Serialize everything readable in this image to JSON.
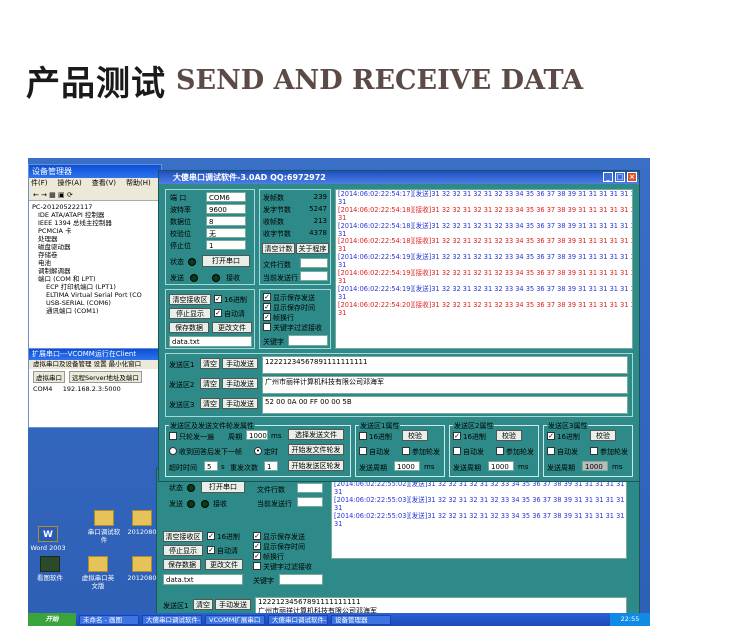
{
  "header": {
    "title_cn": "产品测试",
    "title_en": "SEND AND RECEIVE DATA"
  },
  "device_manager": {
    "title": "设备管理器",
    "menu": [
      "件(F)",
      "操作(A)",
      "查看(V)",
      "帮助(H)"
    ],
    "tree": [
      "PC-201205222117",
      "IDE ATA/ATAPI 控制器",
      "IEEE 1394 总线主控制器",
      "PCMCIA 卡",
      "处理器",
      "磁盘驱动器",
      "存储卷",
      "电池",
      "调制解调器",
      "端口 (COM 和 LPT)",
      "ECP 打印机端口 (LPT1)",
      "ELTIMA Virtual Serial Port (CO",
      "USB-SERIAL (COM6)",
      "通讯端口 (COM1)"
    ]
  },
  "ext_window": {
    "title": "扩展串口---VCOMM运行在Client",
    "menu": "虚拟串口及设备管理  设置  最小化窗口",
    "btn1": "虚拟串口",
    "btn2": "远程Server地址及端口",
    "row_port": "COM4",
    "row_addr": "192.168.2.3:5000"
  },
  "desktop_icons": [
    {
      "label": "Word 2003"
    },
    {
      "label": "串口调试软件"
    },
    {
      "label": "2012080"
    },
    {
      "label": "看图软件"
    },
    {
      "label": "虚拟串口英文版"
    },
    {
      "label": "2012080"
    }
  ],
  "taskbar": {
    "start": "开始",
    "items": [
      "未命名 - 画图",
      "大傻串口调试软件-3...",
      "VCOMM扩展串口",
      "大傻串口调试软件-3...",
      "设备管理器"
    ],
    "clock": "22:55"
  },
  "app": {
    "title": "大傻串口调试软件-3.0AD    QQ:6972972",
    "port_labels": [
      "端  口",
      "波特率",
      "数据位",
      "校验位",
      "停止位"
    ],
    "port_values": [
      "COM6",
      "9600",
      "8",
      "无",
      "1"
    ],
    "status_label": "状态",
    "open_port": "打开串口",
    "send_label": "发送",
    "recv_label": "接收",
    "stats": [
      {
        "label": "发帧数",
        "value": "239"
      },
      {
        "label": "发字节数",
        "value": "5247"
      },
      {
        "label": "收帧数",
        "value": "213"
      },
      {
        "label": "收字节数",
        "value": "4378"
      }
    ],
    "clear_count": "清空计数",
    "about": "关于程序",
    "file_rows": "文件行数",
    "current_row": "当前发送行",
    "clear_recv": "清空接收区",
    "hex16": "16进制",
    "stop_display": "停止显示",
    "auto_clear": "自动清",
    "save_data": "保存数据",
    "change_file": "更改文件",
    "file_name": "data.txt",
    "opts": [
      "显示保存发送",
      "显示保存时间",
      "帧换行",
      "关键字过滤接收"
    ],
    "keyword": "关键字",
    "log": [
      {
        "ts": "[2014:06:02:22:54:17]",
        "tag": "[发送]",
        "data": "31 32 32 31 32 31 32 33 34 35 36 37 38 39 31 31 31 31 31 31 31 31",
        "kind": "send"
      },
      {
        "ts": "[2014:06:02:22:54:18]",
        "tag": "[接收]",
        "data": "31 32 32 31 32 31 32 33 34 35 36 37 38 39 31 31 31 31 31 31 31 31",
        "kind": "recv"
      },
      {
        "ts": "[2014:06:02:22:54:18]",
        "tag": "[发送]",
        "data": "31 32 32 31 32 31 32 33 34 35 36 37 38 39 31 31 31 31 31 31 31 31",
        "kind": "send"
      },
      {
        "ts": "[2014:06:02:22:54:18]",
        "tag": "[接收]",
        "data": "31 32 32 31 32 31 32 33 34 35 36 37 38 39 31 31 31 31 31 31 31 31",
        "kind": "recv"
      },
      {
        "ts": "[2014:06:02:22:54:19]",
        "tag": "[发送]",
        "data": "31 32 32 31 32 31 32 33 34 35 36 37 38 39 31 31 31 31 31 31 31 31",
        "kind": "send"
      },
      {
        "ts": "[2014:06:02:22:54:19]",
        "tag": "[接收]",
        "data": "31 32 32 31 32 31 32 33 34 35 36 37 38 39 31 31 31 31 31 31 31 31",
        "kind": "recv"
      },
      {
        "ts": "[2014:06:02:22:54:19]",
        "tag": "[发送]",
        "data": "31 32 32 31 32 31 32 33 34 35 36 37 38 39 31 31 31 31 31 31 31 31",
        "kind": "send"
      },
      {
        "ts": "[2014:06:02:22:54:20]",
        "tag": "[接收]",
        "data": "31 32 32 31 32 31 32 33 34 35 36 37 38 39 31 31 31 31 31 31 31 31",
        "kind": "recv"
      }
    ],
    "send_areas": [
      {
        "label": "发送区1",
        "value": "12221234567891111111111"
      },
      {
        "label": "发送区2",
        "value": "广州市丽祥计算机科技有限公司邓海军"
      },
      {
        "label": "发送区3",
        "value": "52 00 0A 00 FF 00 00 5B"
      }
    ],
    "clear": "清空",
    "manual_send": "手动发送",
    "cycle_group": "发送区及发送文件轮发属性",
    "send_once": "只轮发一遍",
    "period": "周期",
    "period_val": "1000",
    "ms": "ms",
    "select_file": "选择发送文件",
    "recv_reply": "收到回答后发下一帧",
    "timed": "定时",
    "start_file": "开始发文件轮发",
    "timeout": "超时时间",
    "timeout_val": "5",
    "s": "s",
    "resend": "重发次数",
    "resend_val": "1",
    "start_cycle": "开始发送区轮发",
    "attrs": [
      {
        "title": "发送区1属性",
        "hex": "16进制",
        "check": "校验",
        "auto": "自动发",
        "join": "参加轮发",
        "period_label": "发送周期",
        "period": "1000",
        "ms": "ms"
      },
      {
        "title": "发送区2属性",
        "hex": "16进制",
        "check": "校验",
        "auto": "自动发",
        "join": "参加轮发",
        "period_label": "发送周期",
        "period": "1000",
        "ms": "ms"
      },
      {
        "title": "发送区3属性",
        "hex": "16进制",
        "check": "校验",
        "auto": "自动发",
        "join": "参加轮发",
        "period_label": "发送周期",
        "period": "1000",
        "ms": "ms"
      }
    ]
  },
  "app2": {
    "status_label": "状态",
    "open_port": "打开串口",
    "send_label": "发送",
    "recv_label": "接收",
    "file_rows": "文件行数",
    "current_row": "当前发送行",
    "log": [
      {
        "ts": "[2014:06:02:22:55:02]",
        "tag": "[发送]",
        "data": "31 32 32 31 32 31 32 33 34 35 36 37 38 39 31 31 31 31 31 31 31 31",
        "kind": "send"
      },
      {
        "ts": "[2014:06:02:22:55:03]",
        "tag": "[发送]",
        "data": "31 32 32 31 32 31 32 33 34 35 36 37 38 39 31 31 31 31 31 31 31 31",
        "kind": "send"
      },
      {
        "ts": "[2014:06:02:22:55:03]",
        "tag": "[发送]",
        "data": "31 32 32 31 32 31 32 33 34 35 36 37 38 39 31 31 31 31 31 31 31 31",
        "kind": "send"
      }
    ],
    "clear_recv": "清空接收区",
    "hex16": "16进制",
    "stop_display": "停止显示",
    "auto_clear": "自动清",
    "save_data": "保存数据",
    "change_file": "更改文件",
    "file_name": "data.txt",
    "opts": [
      "显示保存发送",
      "显示保存时间",
      "帧换行",
      "关键字过滤接收"
    ],
    "keyword": "关键字",
    "send_area_label": "发送区1",
    "clear": "清空",
    "manual_send": "手动发送",
    "send_value": "12221234567891111111111",
    "send_value2": "广州市丽祥计算机科技有限公司邓海军"
  }
}
